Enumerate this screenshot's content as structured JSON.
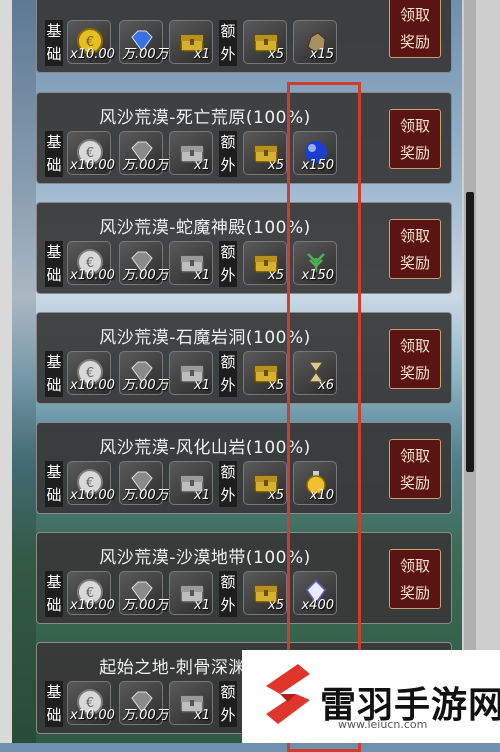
{
  "labels": {
    "base": [
      "基",
      "础"
    ],
    "extra": [
      "额",
      "外"
    ],
    "claim": [
      "领",
      "取",
      "奖",
      "励"
    ],
    "claim_partial": "领取"
  },
  "panels": [
    {
      "title": "",
      "base": [
        "x10.00",
        "万.00万",
        "x1"
      ],
      "extra": [
        "x5",
        "x15"
      ],
      "extra_icon": "ore-icon"
    },
    {
      "title": "风沙荒漠-死亡荒原(100%)",
      "base": [
        "x10.00",
        "万.00万",
        "x1"
      ],
      "extra": [
        "x5",
        "x150"
      ],
      "extra_icon": "blue-orb-icon"
    },
    {
      "title": "风沙荒漠-蛇魔神殿(100%)",
      "base": [
        "x10.00",
        "万.00万",
        "x1"
      ],
      "extra": [
        "x5",
        "x150"
      ],
      "extra_icon": "herb-icon"
    },
    {
      "title": "风沙荒漠-石魔岩洞(100%)",
      "base": [
        "x10.00",
        "万.00万",
        "x1"
      ],
      "extra": [
        "x5",
        "x6"
      ],
      "extra_icon": "hourglass-icon"
    },
    {
      "title": "风沙荒漠-风化山岩(100%)",
      "base": [
        "x10.00",
        "万.00万",
        "x1"
      ],
      "extra": [
        "x5",
        "x10"
      ],
      "extra_icon": "potion-icon"
    },
    {
      "title": "风沙荒漠-沙漠地带(100%)",
      "base": [
        "x10.00",
        "万.00万",
        "x1"
      ],
      "extra": [
        "x5",
        "x400"
      ],
      "extra_icon": "crystal-icon"
    },
    {
      "title": "起始之地-刺骨深渊(100%)",
      "base": [
        "x10.00",
        "万.00万",
        "x1"
      ],
      "extra": [
        "x5",
        ""
      ],
      "extra_icon": ""
    }
  ],
  "watermark": {
    "name": "雷羽手游网",
    "url": "www.leiucn.com"
  },
  "colors": {
    "highlight": "#d23c2a",
    "claim_bg": "#5a1414",
    "panel_bg": "#373737"
  }
}
